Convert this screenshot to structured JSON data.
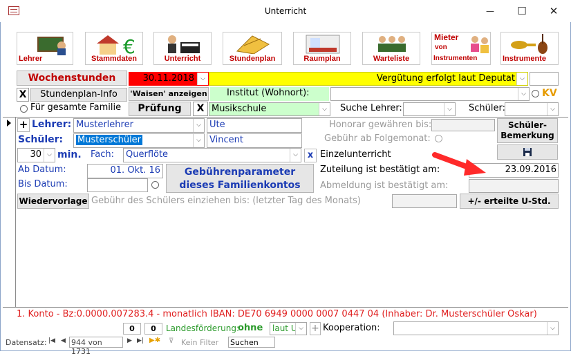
{
  "window": {
    "title": "Unterricht",
    "minimize": "—",
    "maximize": "☐",
    "close": "✕"
  },
  "nav": [
    {
      "id": "lehrer",
      "label": "Lehrer"
    },
    {
      "id": "stammdaten",
      "label": "Stammdaten"
    },
    {
      "id": "unterricht",
      "label": "Unterricht"
    },
    {
      "id": "stundenplan",
      "label": "Stundenplan"
    },
    {
      "id": "raumplan",
      "label": "Raumplan"
    },
    {
      "id": "warteliste",
      "label": "Warteliste"
    },
    {
      "id": "mieter",
      "label": "Mieter von Instrumenten",
      "line1": "Mieter",
      "line2": "von",
      "line3": "Instrumenten"
    },
    {
      "id": "instrumente",
      "label": "Instrumente"
    }
  ],
  "toolbar": {
    "wochenstunden": "Wochenstunden",
    "date": "30.11.2018",
    "verguetung": "Vergütung erfolgt laut Deputat",
    "x1": "X",
    "stundenplan_info": "Stundenplan-Info",
    "waisen": "'Waisen' anzeigen",
    "institut_label": "Institut (Wohnort):",
    "kv": "KV",
    "familie": "Für gesamte Familie",
    "pruefung": "Prüfung",
    "x2": "X",
    "musikschule": "Musikschule",
    "suche_lehrer": "Suche Lehrer:",
    "schueler_label": "Schüler:"
  },
  "form": {
    "plus": "+",
    "lehrer_label": "Lehrer:",
    "lehrer_value": "Musterlehrer",
    "lehrer_vorname": "Ute",
    "schueler_label": "Schüler:",
    "schueler_value": "Musterschüler",
    "schueler_vorname": "Vincent",
    "minutes": "30",
    "min_label": "min.",
    "fach_label": "Fach:",
    "fach_value": "Querflöte",
    "fach_x": "x",
    "ab_datum_label": "Ab Datum:",
    "ab_datum_value": "01. Okt. 16",
    "bis_datum_label": "Bis Datum:",
    "gebuehren_btn": "Gebührenparameter dieses Familienkontos",
    "gebuehren_line1": "Gebührenparameter",
    "gebuehren_line2": "dieses Familienkontos",
    "wiedervorlage": "Wiedervorlage",
    "gebuehr_einziehen": "Gebühr des Schülers einziehen bis:  (letzter Tag des Monats)",
    "honorar": "Honorar gewähren bis:",
    "gebuehr_folgemonat": "Gebühr ab Folgemonat:",
    "einzelunterricht": "Einzelunterricht",
    "zuteilung_label": "Zuteilung ist bestätigt am:",
    "zuteilung_value": "23.09.2016",
    "abmeldung_label": "Abmeldung ist bestätigt am:",
    "schueler_bemerkung": "Schüler-Bemerkung",
    "bemerkung_line1": "Schüler-",
    "bemerkung_line2": "Bemerkung",
    "erteilte": "+/- erteilte U-Std."
  },
  "footer": {
    "konto": "1. Konto - Bz:0.0000.007283.4 - monatlich IBAN: DE70 6949 0000 0007 0447 04 (Inhaber: Dr. Musterschüler Oskar)",
    "zero1": "0",
    "zero2": "0",
    "landesfoerderung": "Landesförderung:",
    "ohne": "ohne",
    "laut": "laut U",
    "plus": "+",
    "kooperation": "Kooperation:"
  },
  "statusbar": {
    "datensatz": "Datensatz:",
    "record": "944 von 1731",
    "kein_filter": "Kein Filter",
    "suchen": "Suchen"
  },
  "colors": {
    "red": "#c00000",
    "yellow": "#ffff00",
    "green": "#ccffcc",
    "blue": "#1c3cb4",
    "select": "#0078d7"
  }
}
